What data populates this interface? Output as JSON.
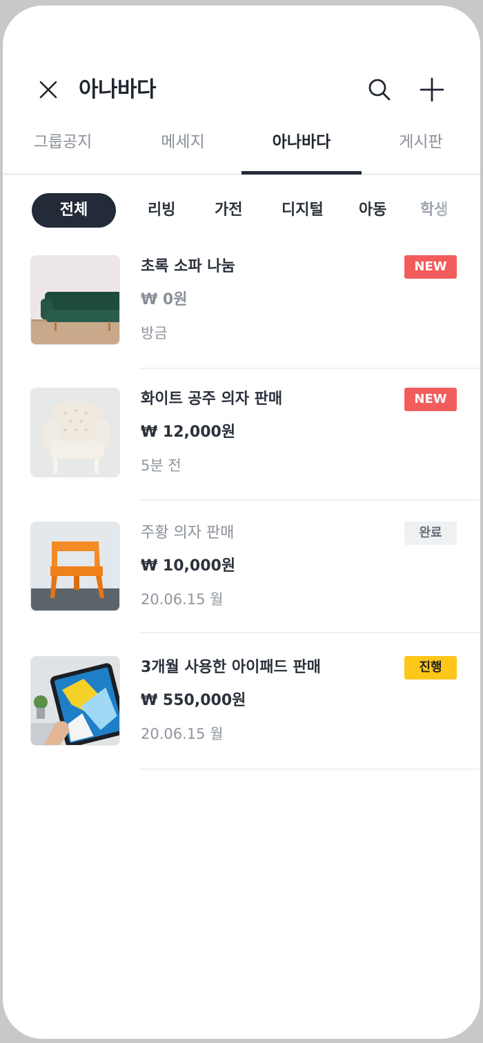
{
  "header": {
    "title": "아나바다"
  },
  "tabs": [
    {
      "label": "그룹공지",
      "active": false
    },
    {
      "label": "메세지",
      "active": false
    },
    {
      "label": "아나바다",
      "active": true
    },
    {
      "label": "게시판",
      "active": false
    }
  ],
  "categories": [
    {
      "label": "전체",
      "active": true
    },
    {
      "label": "리빙",
      "active": false
    },
    {
      "label": "가전",
      "active": false
    },
    {
      "label": "디지털",
      "active": false
    },
    {
      "label": "아동",
      "active": false
    },
    {
      "label": "학생",
      "active": false
    }
  ],
  "listings": [
    {
      "title": "초록 소파 나눔",
      "price": "₩ 0원",
      "time": "방금",
      "badge": "NEW",
      "status": "new",
      "image": "green-sofa"
    },
    {
      "title": "화이트 공주 의자 판매",
      "price": "₩ 12,000원",
      "time": "5분 전",
      "badge": "NEW",
      "status": "new",
      "image": "white-armchair"
    },
    {
      "title": "주황 의자 판매",
      "price": "₩ 10,000원",
      "time": "20.06.15 월",
      "badge": "완료",
      "status": "done",
      "image": "orange-chair"
    },
    {
      "title": "3개월 사용한 아이패드 판매",
      "price": "₩ 550,000원",
      "time": "20.06.15 월",
      "badge": "진행",
      "status": "progress",
      "image": "ipad-tablet"
    }
  ],
  "colors": {
    "dark": "#222b37",
    "badge_new": "#f25c5c",
    "badge_progress": "#ffc61a",
    "badge_done": "#eef0f2"
  }
}
